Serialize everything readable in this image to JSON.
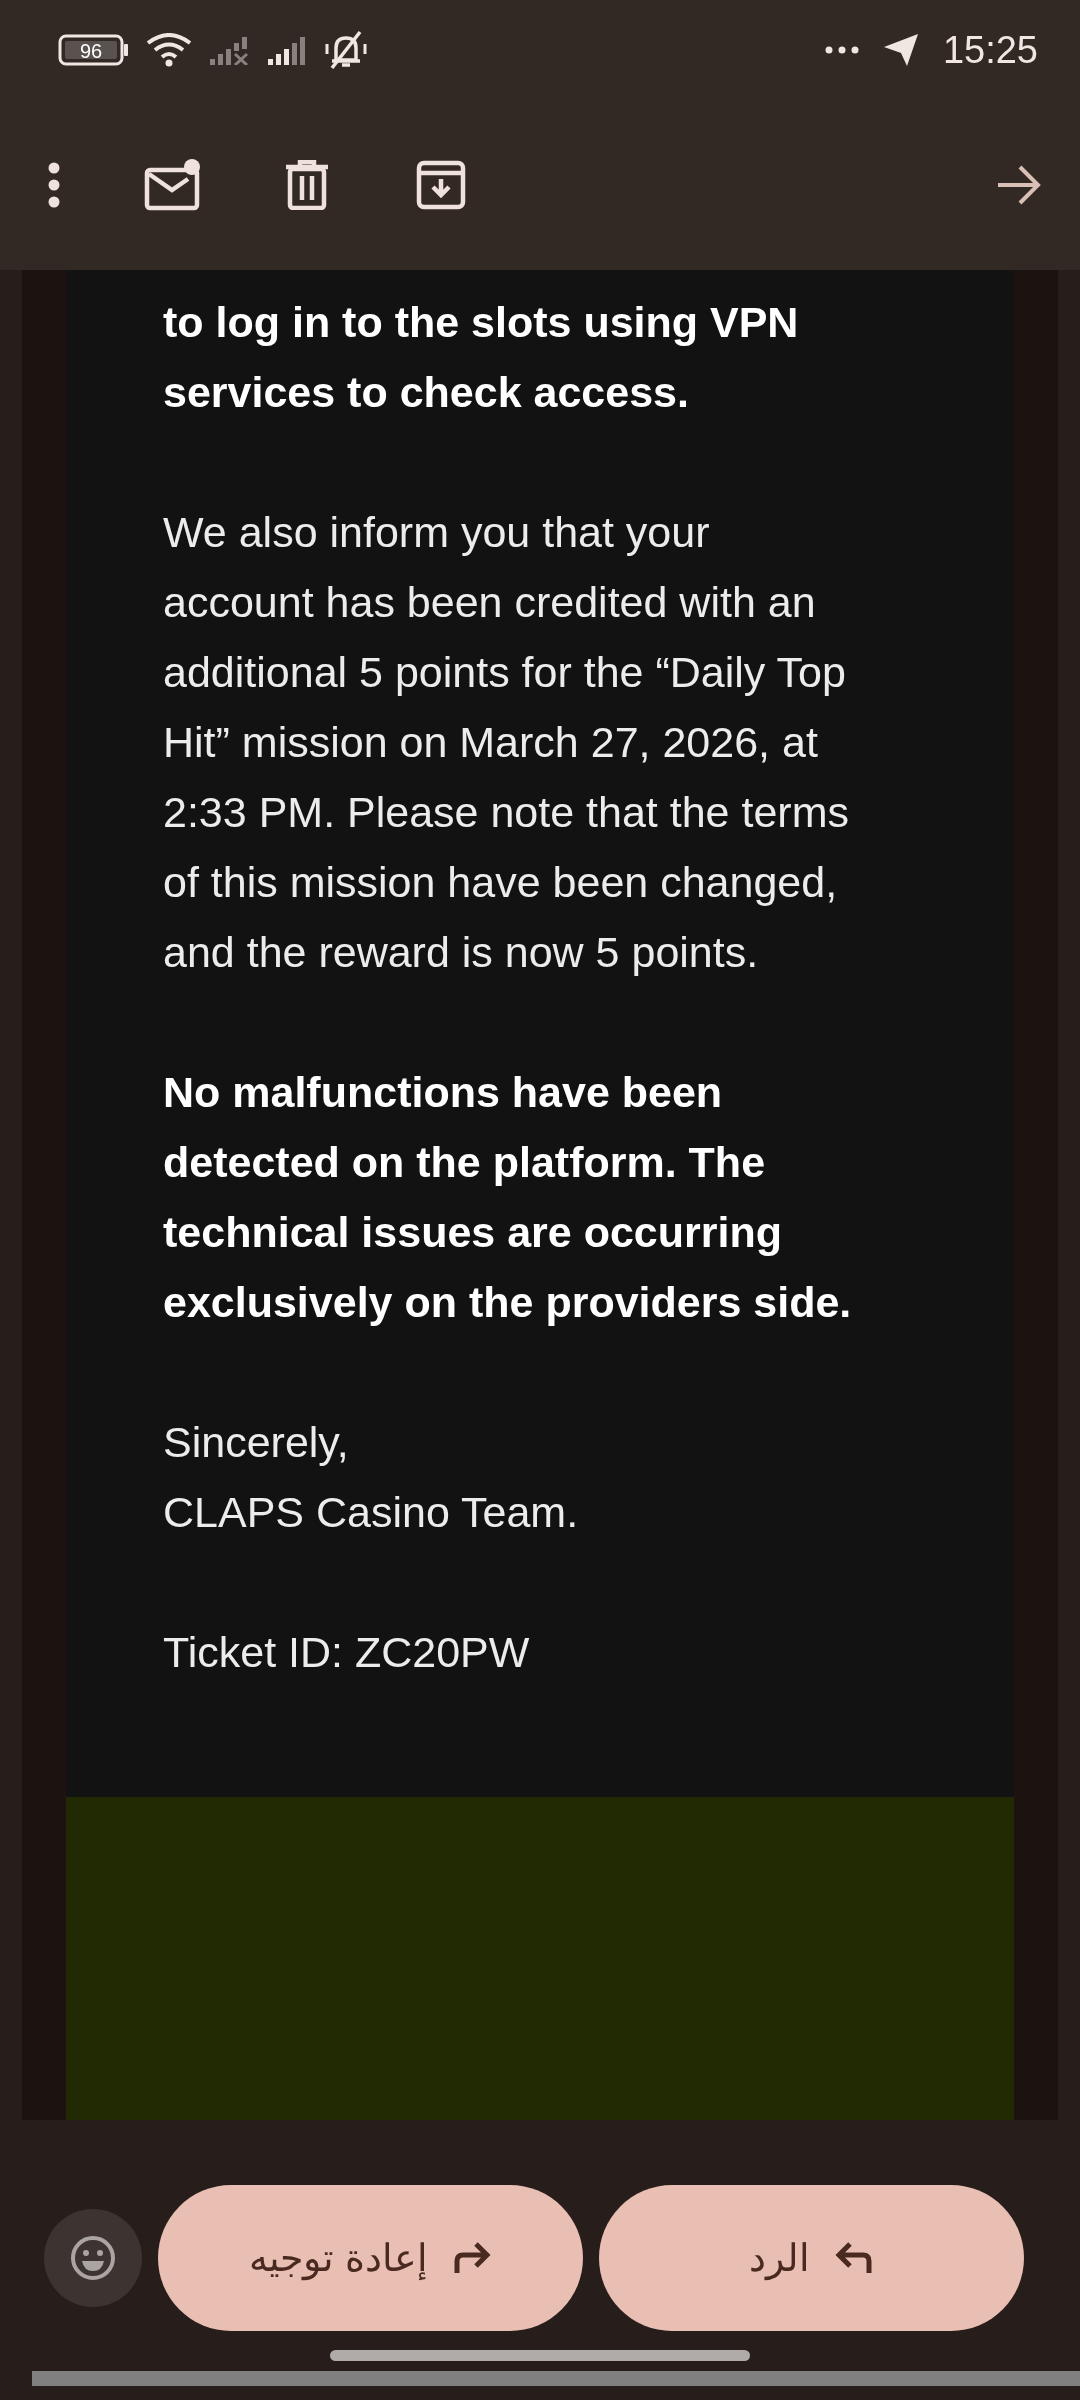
{
  "status_bar": {
    "battery": "96",
    "time": "15:25"
  },
  "message": {
    "paragraphs": [
      {
        "bold": true,
        "lines": [
          "to log in to the slots using VPN",
          "services to check access."
        ]
      },
      {
        "bold": false,
        "lines": [
          "We also inform you that your",
          "account has been credited with an",
          "additional 5 points for the “Daily Top",
          "Hit” mission on March 27, 2026, at",
          "2:33 PM. Please note that the terms",
          "of this mission have been changed,",
          "and the reward is now 5 points."
        ]
      },
      {
        "bold": true,
        "lines": [
          "No malfunctions have been",
          "detected on the platform. The",
          "technical issues are occurring",
          "exclusively on the providers side."
        ]
      },
      {
        "bold": false,
        "lines": [
          "Sincerely,",
          "CLAPS Casino Team."
        ]
      },
      {
        "bold": false,
        "lines": [
          "Ticket ID: ZC20PW"
        ]
      }
    ]
  },
  "actions": [
    {
      "kind": "reply",
      "label": "الرد"
    },
    {
      "kind": "forward",
      "label": "إعادة توجيه"
    }
  ]
}
